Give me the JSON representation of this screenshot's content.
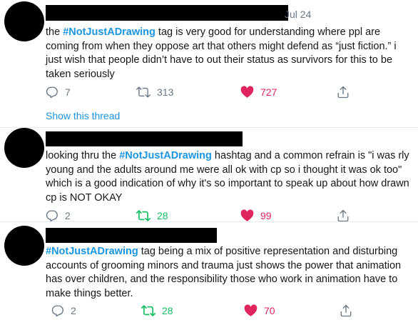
{
  "tweets": [
    {
      "date": "Jul 24",
      "text_before": "the ",
      "hashtag": "#NotJustADrawing",
      "text_after": " tag is very good for understanding where ppl are coming from when they oppose art that others might defend as “just fiction.” i just wish that people didn’t have to out their status as survivors for this to be taken seriously",
      "replies": "7",
      "retweets": "313",
      "likes": "727",
      "retweeted": false,
      "liked": true,
      "show_thread": "Show this thread"
    },
    {
      "text_before": "looking thru the ",
      "hashtag": "#NotJustADrawing",
      "text_after": " hashtag and a common refrain is \"i was rly young and the adults around me were all ok with cp so i thought it was ok too\" which is a good indication of why it's so important to speak up about how drawn cp is NOT OKAY",
      "replies": "2",
      "retweets": "28",
      "likes": "99",
      "retweeted": true,
      "liked": true
    },
    {
      "text_before": "",
      "hashtag": "#NotJustADrawing",
      "text_after": " tag being a mix of positive representation and disturbing accounts of grooming minors and trauma just shows the power that animation has over children, and the responsibility those who work in animation have to make things better.",
      "replies": "2",
      "retweets": "28",
      "likes": "70",
      "retweeted": true,
      "liked": true
    }
  ],
  "icons": {
    "reply": "reply-icon",
    "retweet": "retweet-icon",
    "like": "heart-icon",
    "share": "share-icon"
  },
  "colors": {
    "hashtag": "#1b95e0",
    "retweet_active": "#17bf63",
    "like_active": "#e0245e",
    "muted": "#657786",
    "divider": "#e6ecf0"
  }
}
